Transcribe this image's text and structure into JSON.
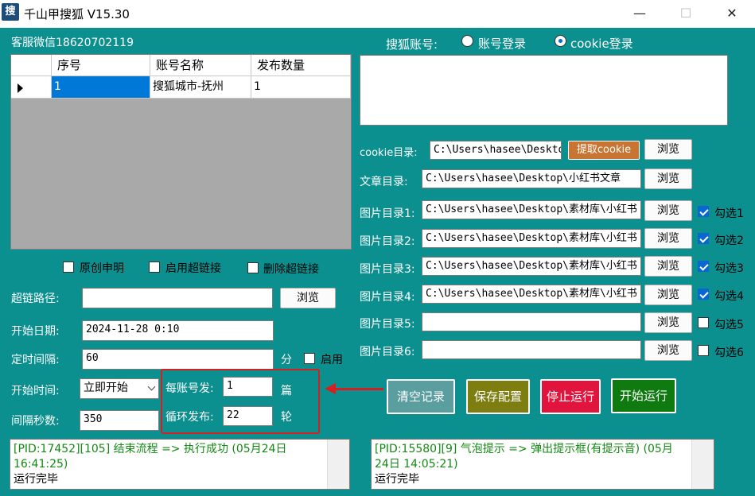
{
  "window": {
    "title": "千山甲搜狐 V15.30",
    "icon_char": "搜",
    "minimize": "—",
    "maximize": "☐",
    "close": "✕"
  },
  "service": "客服微信18620702119",
  "grid": {
    "headers": [
      "序号",
      "账号名称",
      "发布数量"
    ],
    "rows": [
      {
        "index": "1",
        "name": "搜狐城市-抚州",
        "count": "1"
      }
    ]
  },
  "options": {
    "original": "原创申明",
    "enable_link": "启用超链接",
    "delete_link": "删除超链接"
  },
  "form": {
    "link_path_label": "超链路径:",
    "browse": "浏览",
    "start_date_label": "开始日期:",
    "start_date": "2024-11-28  0:10",
    "interval_label": "定时间隔:",
    "interval": "60",
    "minute": "分",
    "enable": "启用",
    "start_time_label": "开始时间:",
    "start_time": "立即开始",
    "interval_sec_label": "间隔秒数:",
    "interval_sec": "350",
    "per_account_label": "每账号发:",
    "per_account": "1",
    "per_account_unit": "篇",
    "loop_label": "循环发布:",
    "loop": "22",
    "loop_unit": "轮"
  },
  "account": {
    "label": "搜狐账号:",
    "opt1": "账号登录",
    "opt2": "cookie登录"
  },
  "dirs": {
    "cookie_label": "cookie目录:",
    "cookie_value": "C:\\Users\\hasee\\Desktop",
    "get_cookie": "提取cookie",
    "article_label": "文章目录:",
    "article_value": "C:\\Users\\hasee\\Desktop\\小红书文章",
    "img": [
      {
        "label": "图片目录1:",
        "value": "C:\\Users\\hasee\\Desktop\\素材库\\小红书",
        "check": "勾选1"
      },
      {
        "label": "图片目录2:",
        "value": "C:\\Users\\hasee\\Desktop\\素材库\\小红书",
        "check": "勾选2"
      },
      {
        "label": "图片目录3:",
        "value": "C:\\Users\\hasee\\Desktop\\素材库\\小红书",
        "check": "勾选3"
      },
      {
        "label": "图片目录4:",
        "value": "C:\\Users\\hasee\\Desktop\\素材库\\小红书",
        "check": "勾选4"
      },
      {
        "label": "图片目录5:",
        "value": "",
        "check": "勾选5"
      },
      {
        "label": "图片目录6:",
        "value": "",
        "check": "勾选6"
      }
    ]
  },
  "actions": {
    "clear": "清空记录",
    "save": "保存配置",
    "stop": "停止运行",
    "start": "开始运行"
  },
  "logs": {
    "left_line1": "[PID:17452][105] 结束流程 => 执行成功 (05月24日",
    "left_line2": "16:41:25)",
    "left_line3": "运行完毕",
    "right_line1": "[PID:15580][9] 气泡提示 => 弹出提示框(有提示音) (05月",
    "right_line2": "24日 14:05:21)",
    "right_line3": "运行完毕"
  },
  "colors": {
    "bg": "#0b8f8f",
    "clear": "#5a9ea0",
    "save": "#7d7d10",
    "stop": "#e0143c",
    "start": "#0f7a0f",
    "highlight": "#d61f1f"
  }
}
